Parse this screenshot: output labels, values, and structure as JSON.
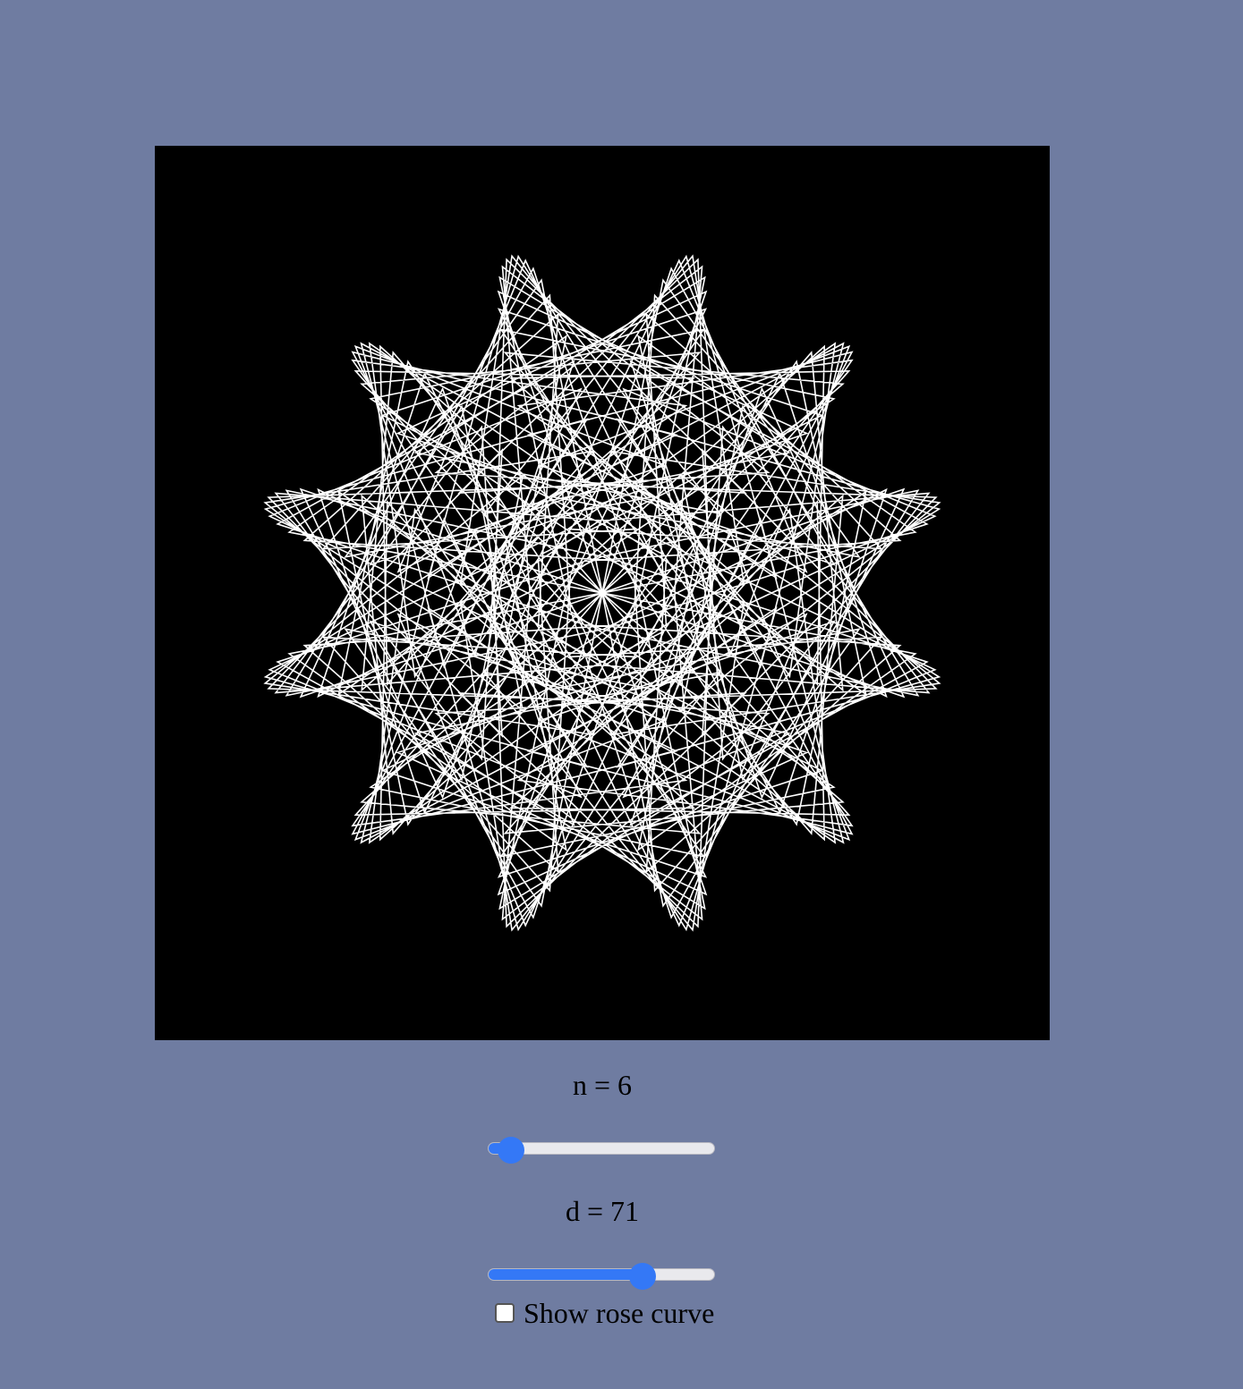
{
  "canvas": {
    "background": "#000000",
    "stroke_color": "#ffffff"
  },
  "controls": {
    "n": {
      "label": "n = 6",
      "value": 6,
      "min": 1,
      "max": 100
    },
    "d": {
      "label": "d = 71",
      "value": 71,
      "min": 1,
      "max": 100
    },
    "show_rose": {
      "label": "Show rose curve",
      "checked": false
    }
  },
  "colors": {
    "page_background": "#6f7ca1",
    "accent": "#3478f6"
  }
}
